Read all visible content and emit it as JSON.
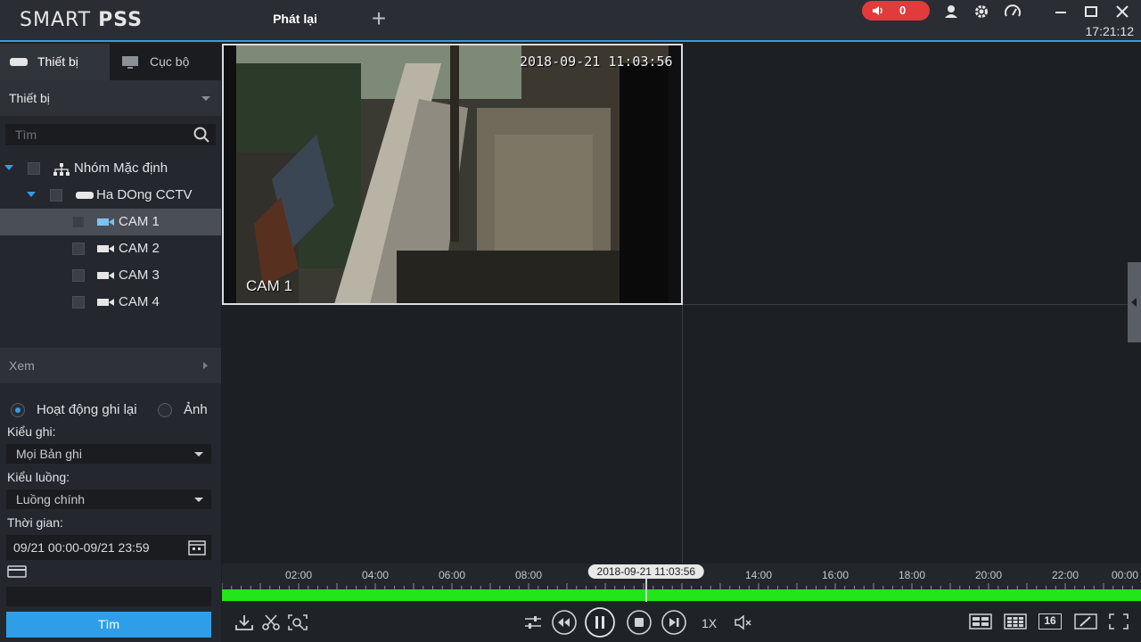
{
  "app": {
    "logo_light": "SMART ",
    "logo_bold": "PSS",
    "active_tab": "Phát lại",
    "add_tab_symbol": "+",
    "alarm_count": "0",
    "clock": "17:21:12",
    "accent_color": "#2f9ee8",
    "alarm_color": "#e23b3b"
  },
  "sidebar": {
    "tabs": [
      {
        "label": "Thiết bị",
        "icon": "device-icon"
      },
      {
        "label": "Cục bộ",
        "icon": "monitor-icon"
      }
    ],
    "device_dropdown": "Thiết bị",
    "search_placeholder": "Tìm",
    "tree": {
      "group": "Nhóm Mặc định",
      "device": "Ha DOng CCTV",
      "cameras": [
        "CAM 1",
        "CAM 2",
        "CAM 3",
        "CAM 4"
      ],
      "selected_camera": "CAM 1"
    },
    "section_view": "Xem",
    "record_options": {
      "option_activity": "Hoạt động ghi lại",
      "option_image": "Ảnh",
      "selected": "Hoạt động ghi lại"
    },
    "record_type_label": "Kiểu ghi:",
    "record_type_value": "Mọi Bản ghi",
    "stream_type_label": "Kiểu luồng:",
    "stream_type_value": "Luồng chính",
    "time_label": "Thời gian:",
    "time_value": "09/21 00:00-09/21 23:59",
    "search_button": "Tìm"
  },
  "video": {
    "osd_timestamp": "2018-09-21 11:03:56",
    "osd_channel": "CAM 1"
  },
  "timeline": {
    "hour_labels": [
      "02:00",
      "04:00",
      "06:00",
      "08:00",
      "14:00",
      "16:00",
      "18:00",
      "20:00",
      "22:00",
      "00:00"
    ],
    "current_time": "2018-09-21 11:03:56",
    "recording_color": "#22e61a"
  },
  "controls": {
    "speed": "1X",
    "layout_16": "16"
  }
}
